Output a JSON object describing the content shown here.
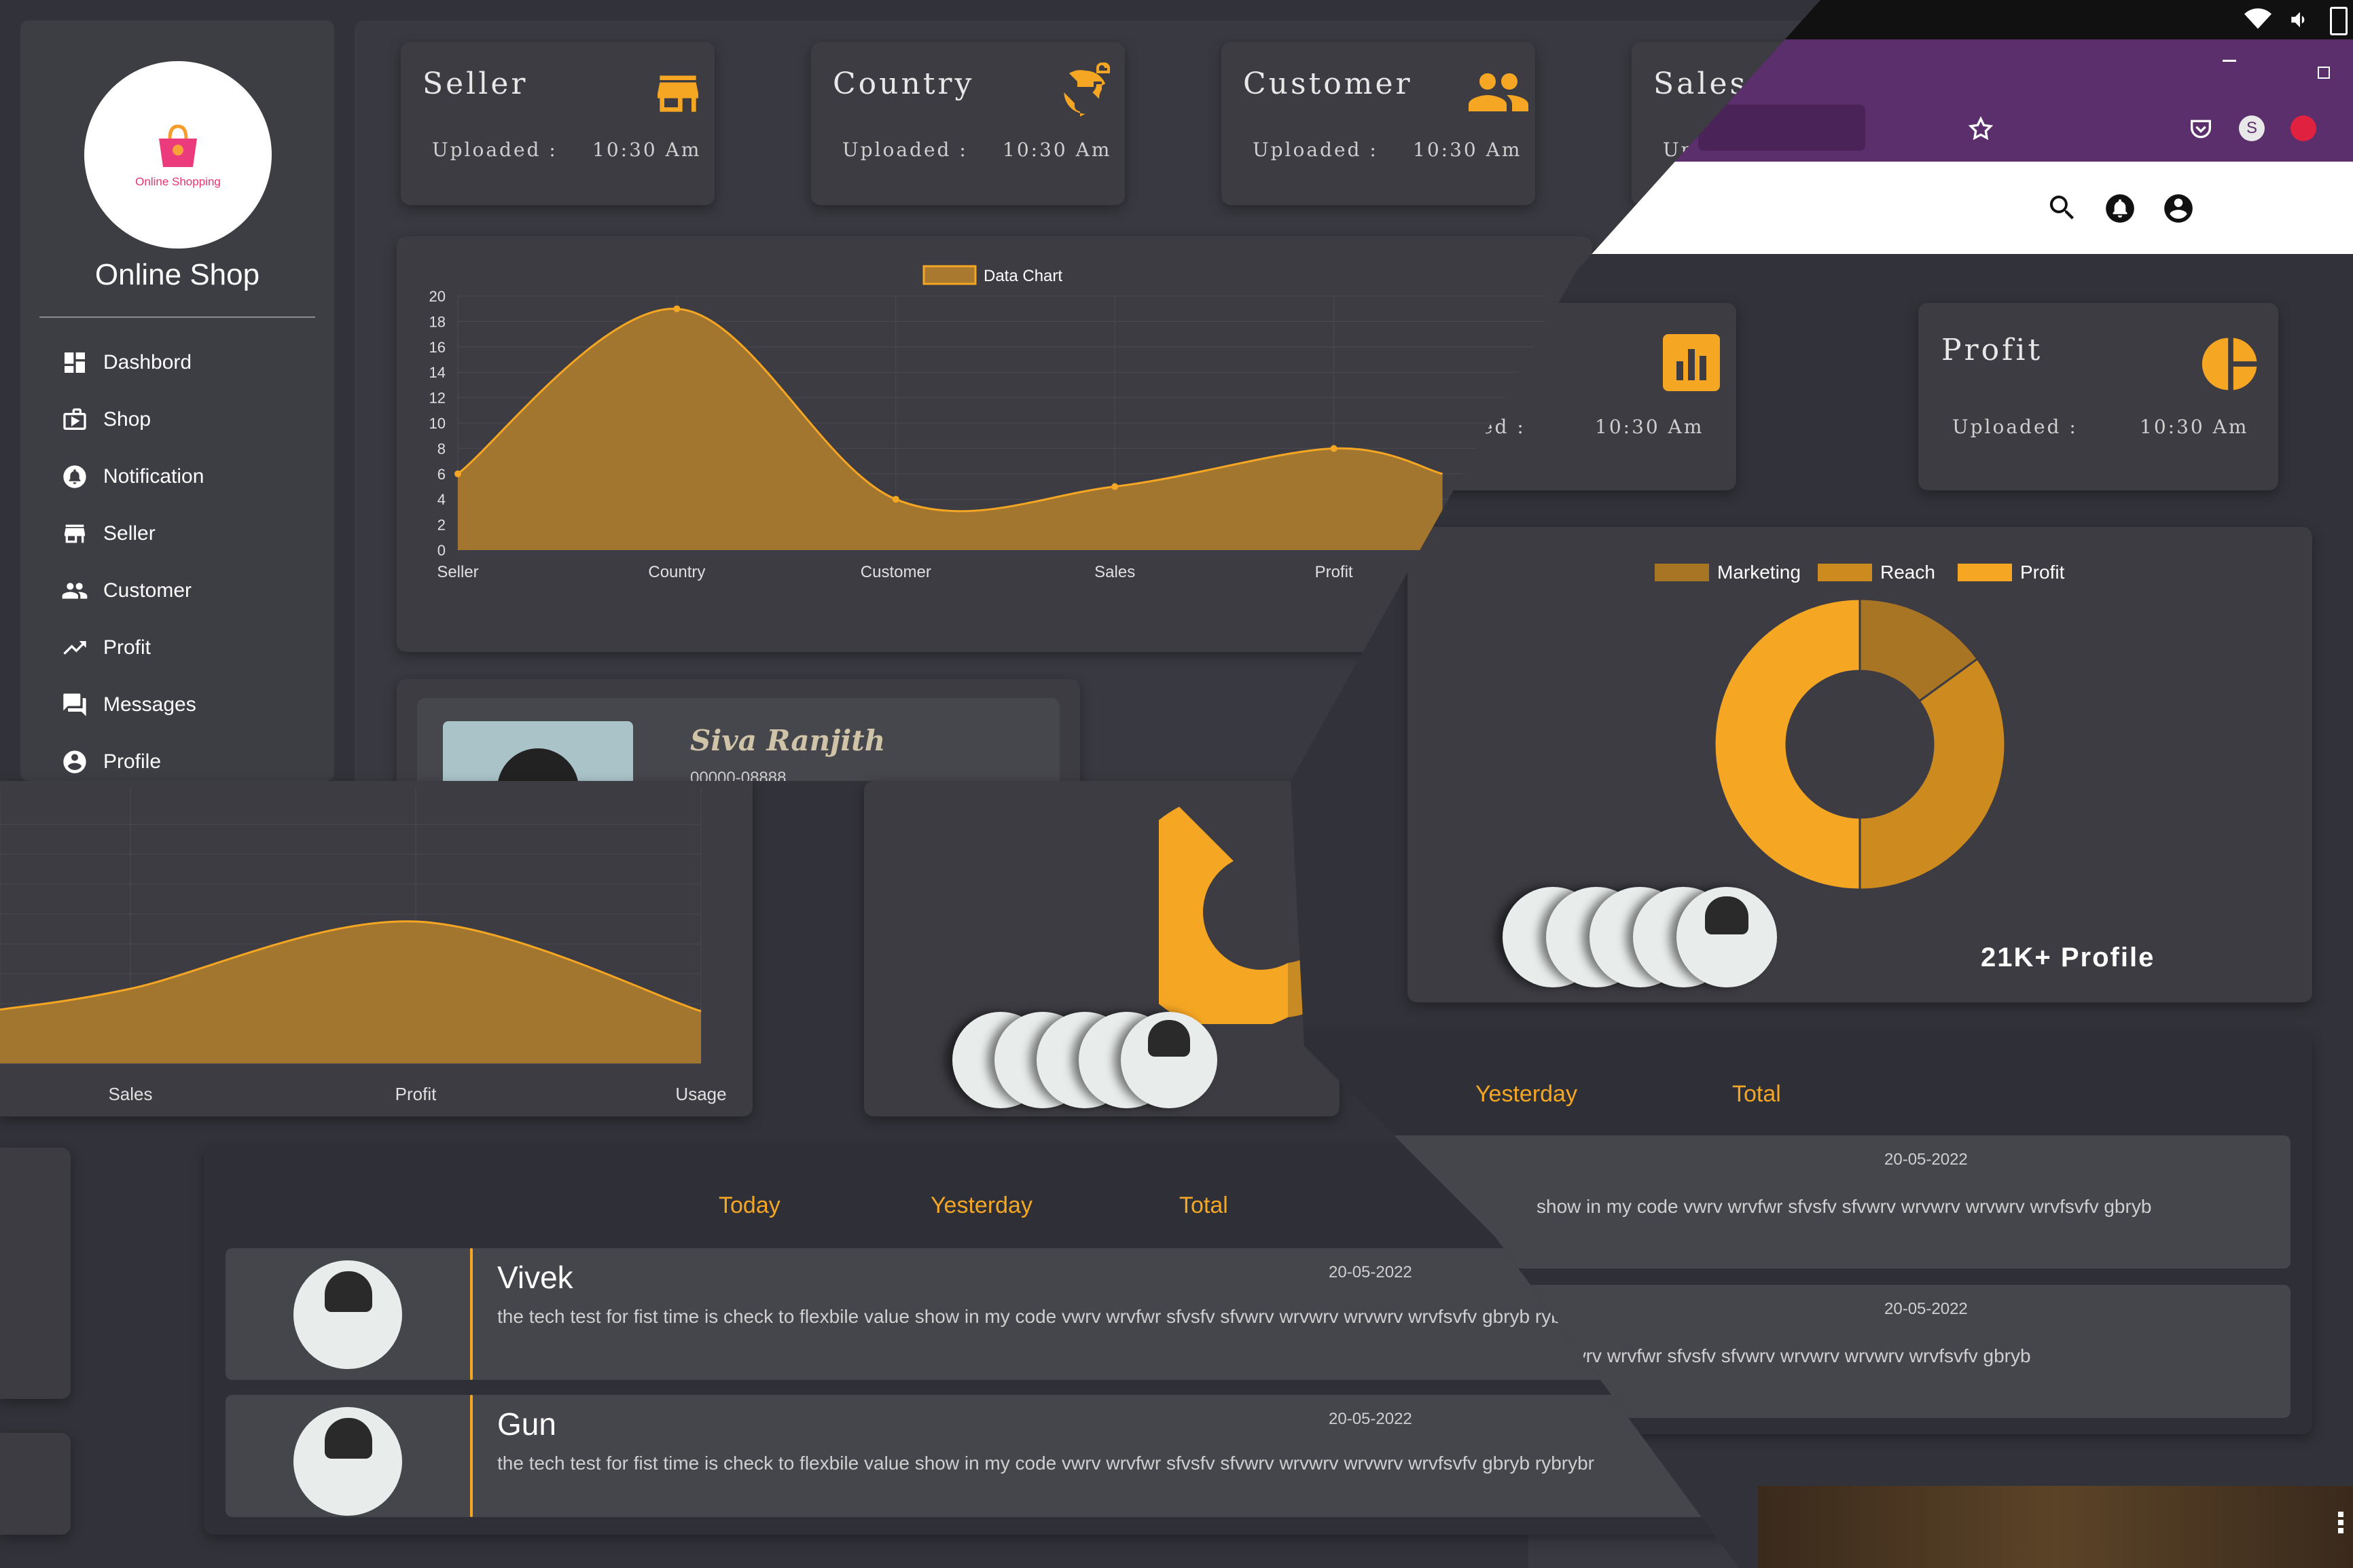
{
  "app": {
    "name": "Online Shop",
    "logo_text": "Online Shopping"
  },
  "sidebar": {
    "items": [
      {
        "label": "Dashbord",
        "icon": "dashboard-icon"
      },
      {
        "label": "Shop",
        "icon": "shop-icon"
      },
      {
        "label": "Notification",
        "icon": "bell-icon"
      },
      {
        "label": "Seller",
        "icon": "store-icon"
      },
      {
        "label": "Customer",
        "icon": "people-icon"
      },
      {
        "label": "Profit",
        "icon": "trend-icon"
      },
      {
        "label": "Messages",
        "icon": "messages-icon"
      },
      {
        "label": "Profile",
        "icon": "profile-icon"
      }
    ]
  },
  "stats": [
    {
      "title": "Seller",
      "sub_label": "Uploaded :",
      "time": "10:30 Am",
      "icon": "store-icon"
    },
    {
      "title": "Country",
      "sub_label": "Uploaded :",
      "time": "10:30 Am",
      "icon": "globe-lock-icon"
    },
    {
      "title": "Customer",
      "sub_label": "Uploaded :",
      "time": "10:30 Am",
      "icon": "people-icon"
    },
    {
      "title": "Sales",
      "sub_label": "Upl",
      "time": "",
      "icon": ""
    },
    {
      "title": "",
      "sub_label": "ded :",
      "time": "10:30 Am",
      "icon": "bar-chart-icon"
    },
    {
      "title": "Profit",
      "sub_label": "Uploaded :",
      "time": "10:30 Am",
      "icon": "pie-icon"
    }
  ],
  "colors": {
    "accent": "#f5a623",
    "area_fill": "#a8792e",
    "background": "#32333a",
    "panel": "#3c3c42",
    "browser_bar": "#5b2f6b"
  },
  "chart_data": [
    {
      "type": "area",
      "legend": [
        "Data Chart"
      ],
      "categories": [
        "Seller",
        "Country",
        "Customer",
        "Sales",
        "Profit"
      ],
      "values": [
        6,
        19,
        4,
        5,
        8
      ],
      "ylim": [
        0,
        20
      ],
      "y_ticks": [
        "0",
        "2",
        "4",
        "6",
        "8",
        "10",
        "12",
        "14",
        "16",
        "18",
        "20"
      ],
      "grid": true
    },
    {
      "type": "area",
      "legend": [],
      "categories": [
        "Sales",
        "Profit",
        "Usage"
      ],
      "values": [
        5,
        9.5,
        3.5
      ],
      "grid": true
    },
    {
      "type": "pie",
      "legend": [
        "Marketing",
        "Reach",
        "Profit"
      ],
      "values": [
        15,
        35,
        50
      ],
      "colors": [
        "#a87525",
        "#cc8a1f",
        "#f5a623"
      ],
      "legend_placement": "top"
    }
  ],
  "profile_card": {
    "name": "Siva Ranjith",
    "phone": "00000-08888"
  },
  "profiles": {
    "count_label": "21K+ Profile"
  },
  "tabs": {
    "today": "Today",
    "yesterday": "Yesterday",
    "total": "Total"
  },
  "messages": [
    {
      "name": "Vivek",
      "date": "20-05-2022",
      "text": "the tech test for fist time is check to flexbile value show in my code vwrv wrvfwr sfvsfv sfvwrv wrvwrv wrvwrv wrvfsvfv gbryb rybrybr"
    },
    {
      "name": "Gun",
      "date": "20-05-2022",
      "text": "the tech test for fist time is check to flexbile value show in my code vwrv wrvfwr sfvsfv sfvwrv wrvwrv wrvwrv wrvfsvfv gbryb rybrybr"
    }
  ],
  "right_messages": [
    {
      "date": "20-05-2022",
      "text": "show in my code vwrv wrvfwr sfvsfv sfvwrv wrvwrv wrvwrv wrvfsvfv gbryb"
    },
    {
      "date": "20-05-2022",
      "text": "code vwrv wrvfwr sfvsfv sfvwrv wrvwrv wrvwrv wrvfsvfv gbryb"
    }
  ]
}
